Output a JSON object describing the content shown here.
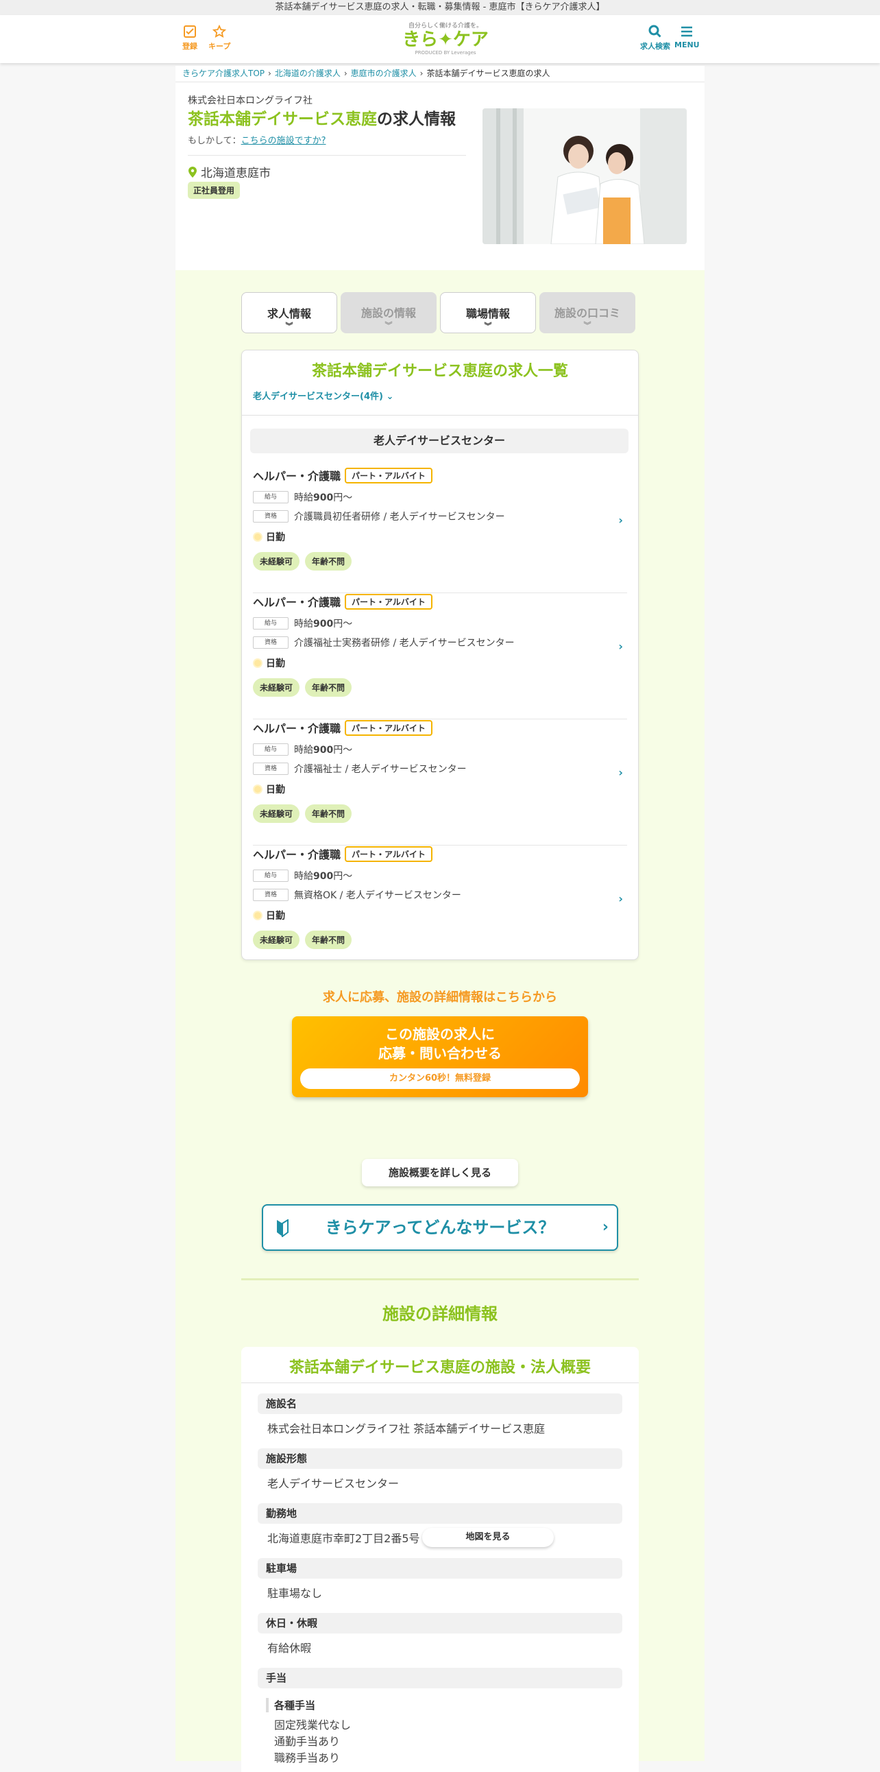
{
  "topbar": {
    "text": "茶話本舗デイサービス恵庭の求人・転職・募集情報 - 恵庭市【きらケア介護求人】"
  },
  "header": {
    "register_label": "登録",
    "keep_label": "キープ",
    "logo_tagline": "自分らしく働ける介護を。",
    "logo_text": "きら✦ケア",
    "logo_sub": "PRODUCED BY Leverages",
    "search_label": "求人検索",
    "menu_label": "MENU",
    "accent": "#f59a23",
    "teal": "#1f8fa6"
  },
  "breadcrumb": [
    "きらケア介護求人TOP",
    "北海道の介護求人",
    "恵庭市の介護求人",
    "茶話本舗デイサービス恵庭の求人"
  ],
  "facility": {
    "corp": "株式会社日本ロングライフ社",
    "name": "茶話本舗デイサービス恵庭",
    "name_suffix": "の求人情報",
    "maybe_prefix": "もしかして：",
    "maybe_link": "こちらの施設ですか?",
    "location": "北海道恵庭市",
    "employment_badge": "正社員登用"
  },
  "tabs": [
    {
      "label": "求人情報",
      "active": true
    },
    {
      "label": "施設の情報",
      "active": false
    },
    {
      "label": "職場情報",
      "active": true
    },
    {
      "label": "施設の口コミ",
      "active": false
    }
  ],
  "job_list": {
    "title": "茶話本舗デイサービス恵庭の求人一覧",
    "filter": "老人デイサービスセンター(4件)",
    "category": "老人デイサービスセンター",
    "salary_tag": "給与",
    "qual_tag": "資格",
    "jobs": [
      {
        "title": "ヘルパー・介護職",
        "type": "パート・アルバイト",
        "salary_pre": "時給",
        "salary_num": "900",
        "salary_post": "円〜",
        "qual": "介護職員初任者研修 / 老人デイサービスセンター",
        "shift": "日勤",
        "tags": [
          "未経験可",
          "年齢不問"
        ]
      },
      {
        "title": "ヘルパー・介護職",
        "type": "パート・アルバイト",
        "salary_pre": "時給",
        "salary_num": "900",
        "salary_post": "円〜",
        "qual": "介護福祉士実務者研修 / 老人デイサービスセンター",
        "shift": "日勤",
        "tags": [
          "未経験可",
          "年齢不問"
        ]
      },
      {
        "title": "ヘルパー・介護職",
        "type": "パート・アルバイト",
        "salary_pre": "時給",
        "salary_num": "900",
        "salary_post": "円〜",
        "qual": "介護福祉士 / 老人デイサービスセンター",
        "shift": "日勤",
        "tags": [
          "未経験可",
          "年齢不問"
        ]
      },
      {
        "title": "ヘルパー・介護職",
        "type": "パート・アルバイト",
        "salary_pre": "時給",
        "salary_num": "900",
        "salary_post": "円〜",
        "qual": "無資格OK / 老人デイサービスセンター",
        "shift": "日勤",
        "tags": [
          "未経験可",
          "年齢不問"
        ]
      }
    ]
  },
  "apply": {
    "heading": "求人に応募、施設の詳細情報はこちらから",
    "button_line1": "この施設の求人に",
    "button_line2": "応募・問い合わせる",
    "button_sub": "カンタン60秒！無料登録"
  },
  "detail_button": "施設概要を詳しく見る",
  "service_button": "きらケアってどんなサービス？",
  "details": {
    "section_title": "施設の詳細情報",
    "card_title": "茶話本舗デイサービス恵庭の施設・法人概要",
    "rows": [
      {
        "label": "施設名",
        "value": "株式会社日本ロングライフ社 茶話本舗デイサービス恵庭"
      },
      {
        "label": "施設形態",
        "value": "老人デイサービスセンター"
      },
      {
        "label": "勤務地",
        "value": "北海道恵庭市幸町2丁目2番5号"
      },
      {
        "label": "駐車場",
        "value": "駐車場なし"
      },
      {
        "label": "休日・休暇",
        "value": "有給休暇"
      },
      {
        "label": "手当",
        "value": ""
      }
    ],
    "map_button": "地図を見る",
    "allowance_heading": "各種手当",
    "allowances": [
      "固定残業代なし",
      "通勤手当あり",
      "職務手当あり"
    ]
  }
}
